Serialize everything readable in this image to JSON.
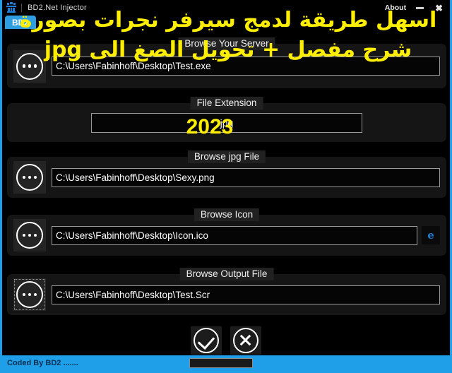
{
  "window": {
    "title": "BD2.Net Injector",
    "app_icon": "app-logo-icon",
    "about_label": "About",
    "minimize_label": "minimize-icon",
    "close_label": "✖",
    "tab_badge": "BD2",
    "accent_color": "#1e9fe8",
    "background_color": "#000000"
  },
  "overlay": {
    "color": "#ffee00",
    "line1": "اسهل طريقة لدمج سيرفر نجرات بصورة",
    "line2": "شرح مفصل + تحويل الصغ الى jpg",
    "year_stamp": "2023"
  },
  "sections": {
    "server": {
      "title": "Browse Your Server",
      "browse_label": "…",
      "path_value": "C:\\Users\\Fabinhoff\\Desktop\\Test.exe"
    },
    "extension": {
      "title": "File Extension",
      "value": "jpg"
    },
    "jpg_file": {
      "title": "Browse jpg File",
      "browse_label": "…",
      "path_value": "C:\\Users\\Fabinhoff\\Desktop\\Sexy.png"
    },
    "icon_file": {
      "title": "Browse Icon",
      "browse_label": "…",
      "path_value": "C:\\Users\\Fabinhoff\\Desktop\\Icon.ico",
      "preview_glyph": "e"
    },
    "output_file": {
      "title": "Browse Output File",
      "browse_label": "…",
      "path_value": "C:\\Users\\Fabinhoff\\Desktop\\Test.Scr"
    }
  },
  "actions": {
    "confirm_label": "check-mark",
    "cancel_label": "cross-mark"
  },
  "statusbar": {
    "text": "Coded By BD2 .......",
    "progress_percent": 0
  }
}
